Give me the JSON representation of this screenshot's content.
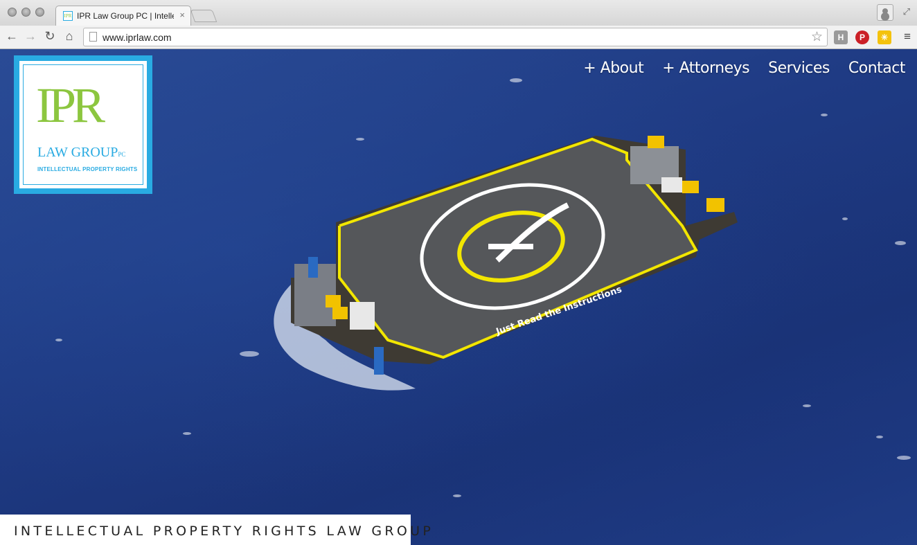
{
  "browser": {
    "tab_title": "IPR Law Group PC | Intellectual Property Rights",
    "tab_favicon_text": "IPR",
    "tab_close": "×",
    "url": "www.iprlaw.com",
    "extensions": [
      {
        "name": "H",
        "color": "#9a9a9a"
      },
      {
        "name": "P",
        "color": "#cb2027"
      },
      {
        "name": "✳",
        "color": "#f4c20d"
      }
    ]
  },
  "header": {
    "logo": {
      "mark": "IPR",
      "firm": "LAW GROUP",
      "firm_suffix": "PC",
      "tagline": "INTELLECTUAL PROPERTY RIGHTS",
      "accent_green": "#8cc63f",
      "accent_blue": "#29abe2"
    },
    "nav": [
      {
        "label": "+ About"
      },
      {
        "label": "+ Attorneys"
      },
      {
        "label": "Services"
      },
      {
        "label": "Contact"
      }
    ]
  },
  "hero": {
    "platform_caption": "Just Read the Instructions"
  },
  "footer": {
    "tagline": "INTELLECTUAL PROPERTY RIGHTS LAW GROUP"
  }
}
